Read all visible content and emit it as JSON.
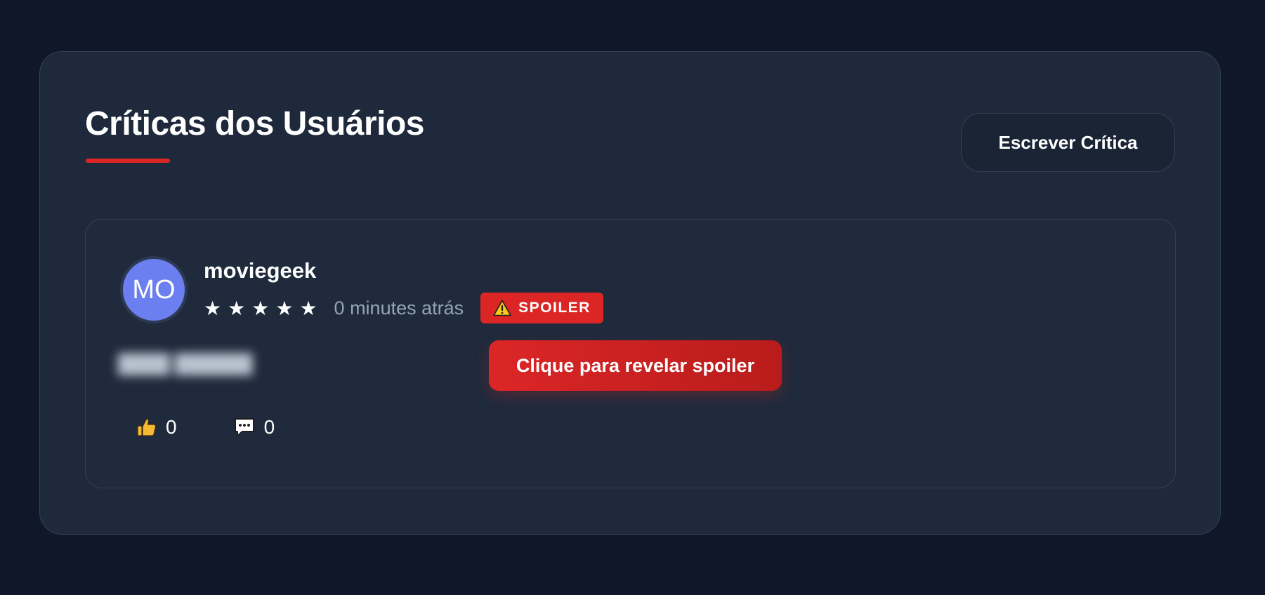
{
  "section": {
    "title": "Críticas dos Usuários",
    "write_button_label": "Escrever Crítica"
  },
  "review": {
    "avatar_initials": "MO",
    "username": "moviegeek",
    "rating": 5,
    "rating_stars": [
      "★",
      "★",
      "★",
      "★",
      "★"
    ],
    "time_ago": "0 minutes atrás",
    "spoiler_badge_label": "SPOILER",
    "spoiler_button_label": "Clique para revelar spoiler",
    "likes_count": "0",
    "comments_count": "0",
    "icons": {
      "warning": "warning-icon",
      "like": "thumbs-up-icon",
      "comment": "speech-bubble-icon"
    }
  },
  "colors": {
    "background": "#0f1729",
    "panel": "#1e293b",
    "accent": "#dc2626",
    "avatar": "#6b7ff0",
    "muted_text": "#94a3b8"
  }
}
